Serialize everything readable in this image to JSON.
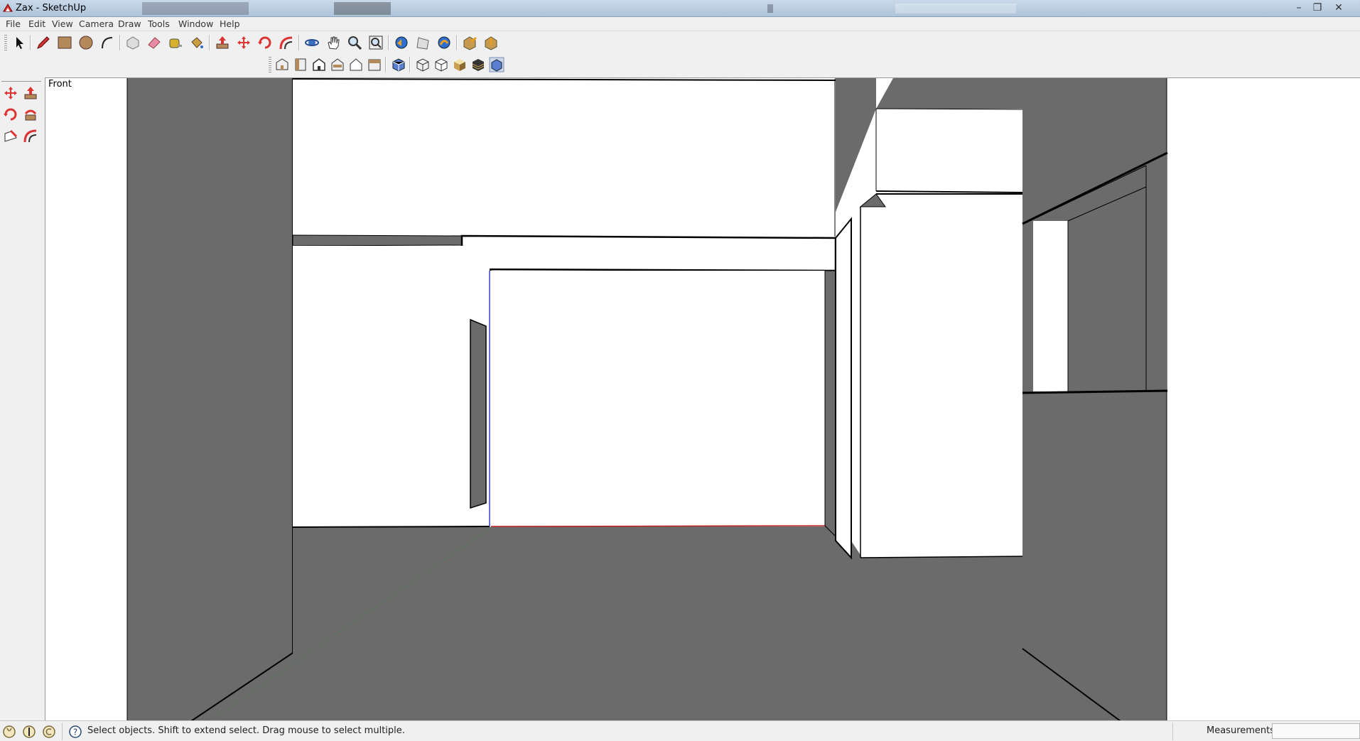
{
  "window": {
    "title": "Zax - SketchUp",
    "controls": [
      "–",
      "❐",
      "✕"
    ]
  },
  "menu": [
    "File",
    "Edit",
    "View",
    "Camera",
    "Draw",
    "Tools",
    "Window",
    "Help"
  ],
  "toolbar_main": [
    {
      "name": "select",
      "icon": "select-arrow-icon"
    },
    {
      "name": "line",
      "icon": "pencil-icon"
    },
    {
      "name": "rectangle",
      "icon": "rectangle-icon"
    },
    {
      "name": "circle",
      "icon": "circle-icon"
    },
    {
      "name": "arc",
      "icon": "arc-icon"
    },
    {
      "name": "make-component",
      "icon": "component-icon"
    },
    {
      "name": "eraser",
      "icon": "eraser-icon"
    },
    {
      "name": "tape-measure",
      "icon": "tape-measure-icon"
    },
    {
      "name": "paint-bucket",
      "icon": "paint-bucket-icon"
    },
    {
      "name": "push-pull",
      "icon": "push-pull-icon"
    },
    {
      "name": "move",
      "icon": "move-icon"
    },
    {
      "name": "rotate",
      "icon": "rotate-icon"
    },
    {
      "name": "offset",
      "icon": "offset-icon"
    },
    {
      "name": "orbit",
      "icon": "orbit-icon"
    },
    {
      "name": "pan",
      "icon": "pan-hand-icon"
    },
    {
      "name": "zoom",
      "icon": "zoom-icon"
    },
    {
      "name": "zoom-extents",
      "icon": "zoom-extents-icon"
    },
    {
      "name": "previous-view",
      "icon": "previous-view-icon"
    },
    {
      "name": "next-view",
      "icon": "next-view-icon"
    },
    {
      "name": "get-models",
      "icon": "get-models-icon"
    },
    {
      "name": "share-model",
      "icon": "share-model-icon"
    },
    {
      "name": "warehouse",
      "icon": "warehouse-icon"
    }
  ],
  "toolbar_views": [
    {
      "name": "iso",
      "icon": "iso-view-icon"
    },
    {
      "name": "top",
      "icon": "top-view-icon"
    },
    {
      "name": "front",
      "icon": "front-view-icon"
    },
    {
      "name": "right",
      "icon": "right-view-icon"
    },
    {
      "name": "back",
      "icon": "back-view-icon"
    },
    {
      "name": "left",
      "icon": "left-view-icon"
    },
    {
      "name": "xray",
      "icon": "xray-icon"
    },
    {
      "name": "wireframe",
      "icon": "wireframe-icon"
    },
    {
      "name": "hidden-line",
      "icon": "hidden-line-icon"
    },
    {
      "name": "shaded",
      "icon": "shaded-icon"
    },
    {
      "name": "shaded-textures",
      "icon": "shaded-textures-icon"
    },
    {
      "name": "monochrome",
      "icon": "monochrome-icon"
    }
  ],
  "toolbar_left": [
    {
      "name": "move",
      "icon": "move-icon"
    },
    {
      "name": "push-pull",
      "icon": "push-pull-icon"
    },
    {
      "name": "rotate",
      "icon": "rotate-icon"
    },
    {
      "name": "follow-me",
      "icon": "follow-me-icon"
    },
    {
      "name": "scale",
      "icon": "scale-icon"
    },
    {
      "name": "offset",
      "icon": "offset-icon"
    }
  ],
  "viewport": {
    "scene_label": "Front",
    "colors": {
      "wall": "#6b6b6b",
      "face": "#ffffff",
      "edge": "#000000"
    }
  },
  "status": {
    "icons": [
      "geo-location-icon",
      "credits-icon",
      "account-icon",
      "help-icon"
    ],
    "hint": "Select objects. Shift to extend select. Drag mouse to select multiple.",
    "measurements_label": "Measurements",
    "measurements_value": ""
  }
}
